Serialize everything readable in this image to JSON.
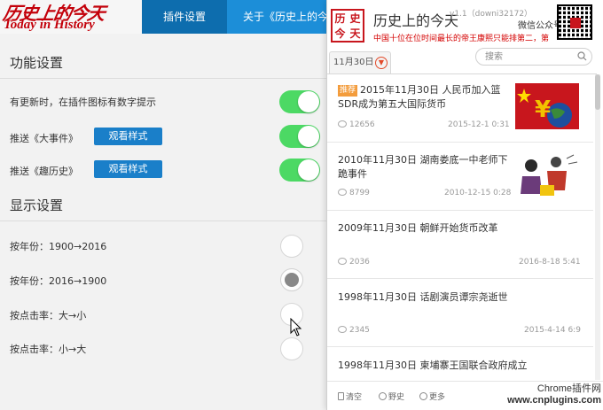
{
  "header": {
    "logo_cn": "历史上的今天",
    "logo_en": "Today in History",
    "tabs": [
      {
        "label": "插件设置"
      },
      {
        "label": "关于《历史上的今天》"
      }
    ]
  },
  "settings": {
    "function_title": "功能设置",
    "display_title": "显示设置",
    "rows": {
      "update_badge": "有更新时，在插件图标有数字提示",
      "push_events": "推送《大事件》",
      "push_fun": "推送《趣历史》"
    },
    "view_style_label": "观看样式",
    "sort_options": [
      {
        "label": "按年份：1900→2016",
        "selected": false
      },
      {
        "label": "按年份：2016→1900",
        "selected": true
      },
      {
        "label": "按点击率：大→小",
        "selected": false
      },
      {
        "label": "按点击率：小→大",
        "selected": false
      }
    ],
    "toggle_color": "#4cd964"
  },
  "popup": {
    "seal_chars": [
      "历",
      "史",
      "今",
      "天"
    ],
    "title": "历史上的今天",
    "version": "v1.1（downi32172）",
    "marquee": "中国十位在位时间最长的帝王康熙只能排第二，第",
    "wechat_label": "微信公众号",
    "date_tab": "11月30日",
    "search_placeholder": "搜索",
    "news": [
      {
        "badge": "推荐",
        "title": "2015年11月30日 人民币加入篮SDR成为第五大国际货币",
        "count": "12656",
        "date": "2015-12-1 0:31",
        "thumb": "flag"
      },
      {
        "title": "2010年11月30日 湖南娄底一中老师下跪事件",
        "count": "8799",
        "date": "2010-12-15 0:28",
        "thumb": "cartoon"
      },
      {
        "title": "2009年11月30日 朝鲜开始货币改革",
        "count": "2036",
        "date": "2016-8-18 5:41"
      },
      {
        "title": "1998年11月30日 话剧演员谭宗尧逝世",
        "count": "2345",
        "date": "2015-4-14 6:9"
      },
      {
        "title": "1998年11月30日 柬埔寨王国联合政府成立"
      }
    ],
    "footer": {
      "clear": "清空",
      "wild_history": "野史",
      "more": "更多"
    }
  },
  "watermark": {
    "line1": "Chrome插件网",
    "line2": "www.cnplugins.com"
  }
}
